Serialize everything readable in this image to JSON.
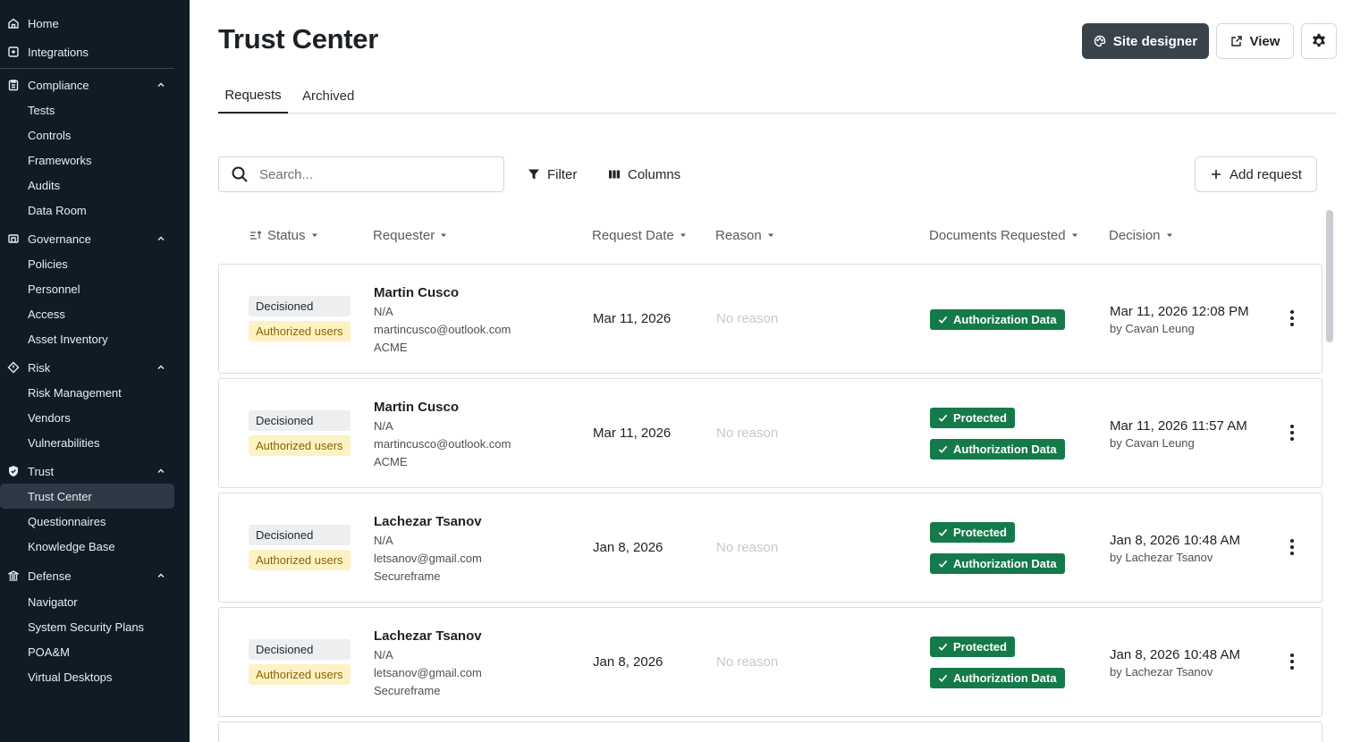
{
  "sidebar": {
    "home": "Home",
    "integrations": "Integrations",
    "sections": [
      {
        "label": "Compliance",
        "items": [
          "Tests",
          "Controls",
          "Frameworks",
          "Audits",
          "Data Room"
        ]
      },
      {
        "label": "Governance",
        "items": [
          "Policies",
          "Personnel",
          "Access",
          "Asset Inventory"
        ]
      },
      {
        "label": "Risk",
        "items": [
          "Risk Management",
          "Vendors",
          "Vulnerabilities"
        ]
      },
      {
        "label": "Trust",
        "items": [
          "Trust Center",
          "Questionnaires",
          "Knowledge Base"
        ]
      },
      {
        "label": "Defense",
        "items": [
          "Navigator",
          "System Security Plans",
          "POA&M",
          "Virtual Desktops"
        ]
      }
    ],
    "active_item": "Trust Center"
  },
  "header": {
    "title": "Trust Center",
    "site_designer": "Site designer",
    "view": "View"
  },
  "tabs": [
    "Requests",
    "Archived"
  ],
  "toolbar": {
    "search_placeholder": "Search...",
    "filter": "Filter",
    "columns": "Columns",
    "add_request": "Add request"
  },
  "table": {
    "columns": [
      "Status",
      "Requester",
      "Request Date",
      "Reason",
      "Documents Requested",
      "Decision"
    ],
    "rows": [
      {
        "status": [
          "Decisioned",
          "Authorized users"
        ],
        "requester": {
          "name": "Martin Cusco",
          "title": "N/A",
          "email": "martincusco@outlook.com",
          "company": "ACME"
        },
        "request_date": "Mar 11, 2026",
        "reason": "No reason",
        "documents": [
          "Authorization Data"
        ],
        "decision": {
          "date": "Mar 11, 2026 12:08 PM",
          "by": "by Cavan Leung"
        }
      },
      {
        "status": [
          "Decisioned",
          "Authorized users"
        ],
        "requester": {
          "name": "Martin Cusco",
          "title": "N/A",
          "email": "martincusco@outlook.com",
          "company": "ACME"
        },
        "request_date": "Mar 11, 2026",
        "reason": "No reason",
        "documents": [
          "Protected",
          "Authorization Data"
        ],
        "decision": {
          "date": "Mar 11, 2026 11:57 AM",
          "by": "by Cavan Leung"
        }
      },
      {
        "status": [
          "Decisioned",
          "Authorized users"
        ],
        "requester": {
          "name": "Lachezar Tsanov",
          "title": "N/A",
          "email": "letsanov@gmail.com",
          "company": "Secureframe"
        },
        "request_date": "Jan 8, 2026",
        "reason": "No reason",
        "documents": [
          "Protected",
          "Authorization Data"
        ],
        "decision": {
          "date": "Jan 8, 2026 10:48 AM",
          "by": "by Lachezar Tsanov"
        }
      },
      {
        "status": [
          "Decisioned",
          "Authorized users"
        ],
        "requester": {
          "name": "Lachezar Tsanov",
          "title": "N/A",
          "email": "letsanov@gmail.com",
          "company": "Secureframe"
        },
        "request_date": "Jan 8, 2026",
        "reason": "No reason",
        "documents": [
          "Protected",
          "Authorization Data"
        ],
        "decision": {
          "date": "Jan 8, 2026 10:48 AM",
          "by": "by Lachezar Tsanov"
        }
      }
    ]
  },
  "colors": {
    "sidebar_bg": "#0f1c26",
    "sidebar_active": "#2d3a45",
    "primary_button": "#3a434b",
    "doc_badge": "#157a4a",
    "authorized_badge_bg": "#fdf2c4",
    "authorized_badge_text": "#8a6500"
  }
}
